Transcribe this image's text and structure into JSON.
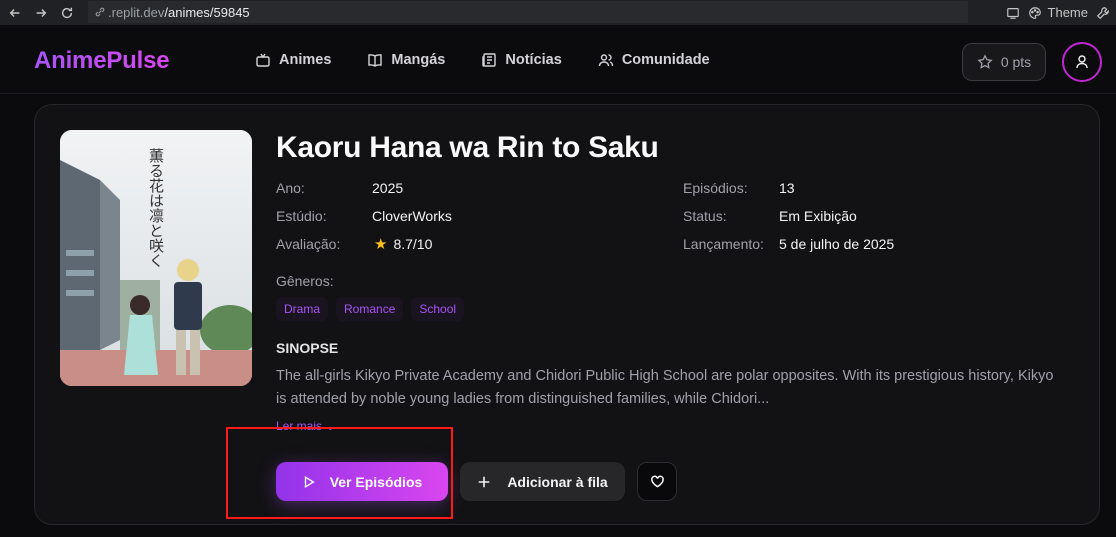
{
  "browser": {
    "url_host": ".replit.dev",
    "url_path": "/animes/59845",
    "theme_label": "Theme"
  },
  "header": {
    "logo": "AnimePulse",
    "nav": [
      {
        "label": "Animes",
        "icon": "tv-icon"
      },
      {
        "label": "Mangás",
        "icon": "book-icon"
      },
      {
        "label": "Notícias",
        "icon": "newspaper-icon"
      },
      {
        "label": "Comunidade",
        "icon": "users-icon"
      }
    ],
    "points": "0 pts"
  },
  "anime": {
    "title": "Kaoru Hana wa Rin to Saku",
    "details_left": [
      {
        "label": "Ano:",
        "value": "2025"
      },
      {
        "label": "Estúdio:",
        "value": "CloverWorks"
      },
      {
        "label": "Avaliação:",
        "value": "8.7/10"
      }
    ],
    "details_right": [
      {
        "label": "Episódios:",
        "value": "13"
      },
      {
        "label": "Status:",
        "value": "Em Exibição"
      },
      {
        "label": "Lançamento:",
        "value": "5 de julho de 2025"
      }
    ],
    "genres_label": "Gêneros:",
    "genres": [
      "Drama",
      "Romance",
      "School"
    ],
    "synopsis_title": "SINOPSE",
    "synopsis": "The all-girls Kikyo Private Academy and Chidori Public High School are polar opposites. With its prestigious history, Kikyo is attended by noble young ladies from distinguished families, while Chidori...",
    "read_more": "Ler mais ⌄",
    "poster_text": "薫る花は凛と咲く"
  },
  "actions": {
    "watch": "Ver Episódios",
    "queue": "Adicionar à fila"
  },
  "colors": {
    "accent": "#a855f7",
    "accent2": "#d946ef",
    "background": "#0b0b0d",
    "card": "#121214",
    "highlight": "#ff1a1a"
  }
}
